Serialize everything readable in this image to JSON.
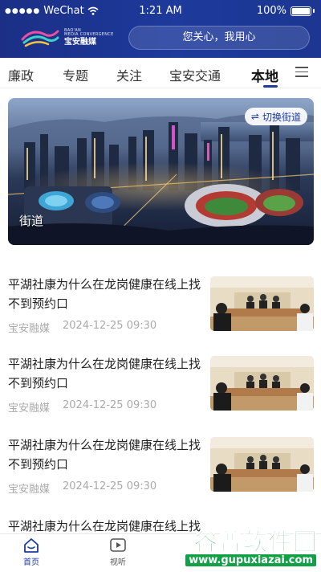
{
  "status_bar": {
    "carrier": "WeChat",
    "time": "1:21 AM",
    "battery": "100%"
  },
  "brand": {
    "en_line1": "BAO'AN",
    "en_line2": "MEDIA CONVERGENCE",
    "cn_name": "宝安融媒"
  },
  "search": {
    "placeholder": "您关心，我用心"
  },
  "tabs": [
    {
      "label": "廉政",
      "active": false
    },
    {
      "label": "专题",
      "active": false
    },
    {
      "label": "关注",
      "active": false
    },
    {
      "label": "宝安交通",
      "active": false
    },
    {
      "label": "本地",
      "active": true
    }
  ],
  "banner": {
    "switch_label": "切换街道",
    "caption": "街道"
  },
  "news": [
    {
      "title": "平湖社康为什么在龙岗健康在线上找不到预约口",
      "source": "宝安融媒",
      "datetime": "2024-12-25 09:30"
    },
    {
      "title": "平湖社康为什么在龙岗健康在线上找不到预约口",
      "source": "宝安融媒",
      "datetime": "2024-12-25 09:30"
    },
    {
      "title": "平湖社康为什么在龙岗健康在线上找不到预约口",
      "source": "宝安融媒",
      "datetime": "2024-12-25 09:30"
    },
    {
      "title": "平湖社康为什么在龙岗健康在线上找不到预约口",
      "source": "",
      "datetime": ""
    }
  ],
  "bottom_nav": [
    {
      "label": "首页",
      "icon": "home-icon",
      "active": true
    },
    {
      "label": "视听",
      "icon": "play-icon",
      "active": false
    }
  ],
  "watermark": {
    "cn": "谷普软件园",
    "url": "www.gupuxiazai.com"
  },
  "colors": {
    "brand_blue": "#1d3a9c",
    "header_dark": "#1b2f86",
    "meta_gray": "#aaaaaa",
    "watermark_green": "#12a046"
  }
}
